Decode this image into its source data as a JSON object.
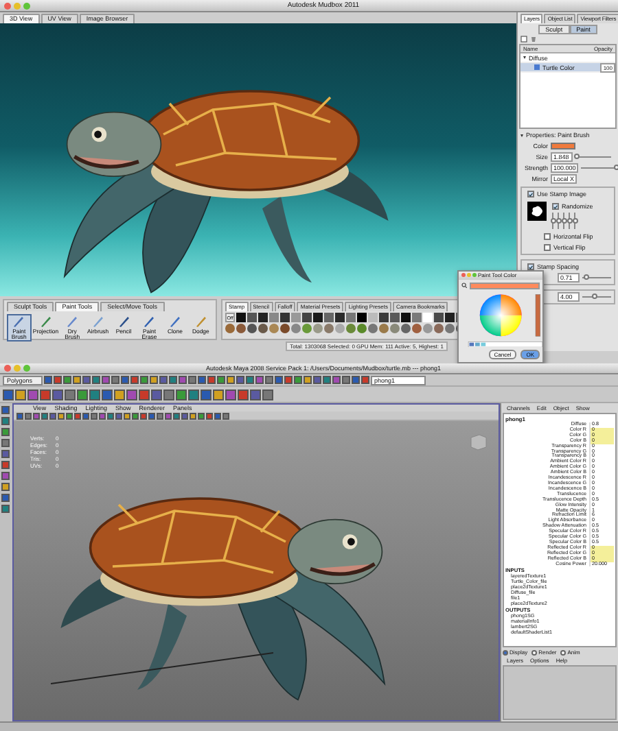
{
  "mudbox": {
    "title": "Autodesk Mudbox 2011",
    "view_tabs": [
      {
        "label": "3D View",
        "selected": true
      },
      {
        "label": "UV View",
        "selected": false
      },
      {
        "label": "Image Browser",
        "selected": false
      }
    ],
    "panel_tabs": [
      {
        "label": "Layers",
        "selected": true
      },
      {
        "label": "Object List",
        "selected": false
      },
      {
        "label": "Viewport Filters",
        "selected": false
      }
    ],
    "mode_buttons": [
      {
        "label": "Sculpt",
        "selected": false
      },
      {
        "label": "Paint",
        "selected": true
      }
    ],
    "layer_columns": [
      "Name",
      "Opacity"
    ],
    "layers": [
      {
        "name": "Diffuse",
        "expanded": true,
        "children": [
          {
            "name": "Turtle Color",
            "opacity": "100",
            "selected": true
          }
        ]
      }
    ],
    "properties": {
      "title": "Properties: Paint Brush",
      "expanded": true,
      "color_label": "Color",
      "color": "#f07a3c",
      "sliders": [
        {
          "label": "Size",
          "value": "1.848",
          "level": 0.05
        },
        {
          "label": "Strength",
          "value": "100.000",
          "level": 1
        }
      ],
      "mirror": {
        "label": "Mirror",
        "value": "Local X"
      },
      "stamp": {
        "label": "Use Stamp Image",
        "checked": true,
        "randomize": {
          "label": "Randomize",
          "checked": true,
          "sliders": [
            {
              "level": 0.5
            },
            {
              "level": 0.5
            },
            {
              "level": 0.5
            },
            {
              "level": 0.5
            },
            {
              "level": 0.5
            }
          ]
        },
        "flips": [
          {
            "label": "Horizontal Flip",
            "checked": false
          },
          {
            "label": "Vertical Flip",
            "checked": false
          }
        ]
      },
      "spacing": {
        "label": "Stamp Spacing",
        "checked": true,
        "value": "0.71",
        "level": 0.15
      },
      "second": {
        "value": "4.00",
        "level": 0.45
      }
    },
    "tool_tabs": [
      {
        "label": "Sculpt Tools",
        "selected": false
      },
      {
        "label": "Paint Tools",
        "selected": true
      },
      {
        "label": "Select/Move Tools",
        "selected": false
      }
    ],
    "tools": [
      {
        "label": "Paint Brush",
        "selected": true
      },
      {
        "label": "Projection",
        "selected": false
      },
      {
        "label": "Dry Brush",
        "selected": false
      },
      {
        "label": "Airbrush",
        "selected": false
      },
      {
        "label": "Pencil",
        "selected": false
      },
      {
        "label": "Paint Erase",
        "selected": false
      },
      {
        "label": "Clone",
        "selected": false
      },
      {
        "label": "Dodge",
        "selected": false
      }
    ],
    "tray_tabs": [
      {
        "label": "Stamp",
        "selected": true
      },
      {
        "label": "Stencil",
        "selected": false
      },
      {
        "label": "Falloff",
        "selected": false
      },
      {
        "label": "Material Presets",
        "selected": false
      },
      {
        "label": "Lighting Presets",
        "selected": false
      },
      {
        "label": "Camera Bookmarks",
        "selected": false
      }
    ],
    "stamp_off": "Off",
    "picker": {
      "title": "Paint Tool Color",
      "color": "#ff8a5c",
      "buttons": [
        "Cancel",
        "OK"
      ]
    },
    "status": "Total: 1303068 Selected: 0 GPU Mem: 111 Active: 5, Highest: 1"
  },
  "maya": {
    "title": "Autodesk Maya 2008 Service Pack 1: /Users/Documents/Mudbox/turtle.mb --- phong1",
    "menu_set": "Polygons",
    "field": "phong1",
    "panel_menu": [
      "View",
      "Shading",
      "Lighting",
      "Show",
      "Renderer",
      "Panels"
    ],
    "hud": [
      {
        "label": "Verts:",
        "value": "0"
      },
      {
        "label": "Edges:",
        "value": "0"
      },
      {
        "label": "Faces:",
        "value": "0"
      },
      {
        "label": "Tris:",
        "value": "0"
      },
      {
        "label": "UVs:",
        "value": "0"
      }
    ],
    "channel_tabs": [
      "Channels",
      "Edit",
      "Object",
      "Show"
    ],
    "node": "phong1",
    "attributes": [
      {
        "name": "Diffuse",
        "value": "0.8",
        "connected": false
      },
      {
        "name": "Color R",
        "value": "0",
        "connected": true
      },
      {
        "name": "Color G",
        "value": "0",
        "connected": true
      },
      {
        "name": "Color B",
        "value": "0",
        "connected": true
      },
      {
        "name": "Transparency R",
        "value": "0",
        "connected": false
      },
      {
        "name": "Transparency G",
        "value": "0",
        "connected": false
      },
      {
        "name": "Transparency B",
        "value": "0",
        "connected": false
      },
      {
        "name": "Ambient Color R",
        "value": "0",
        "connected": false
      },
      {
        "name": "Ambient Color G",
        "value": "0",
        "connected": false
      },
      {
        "name": "Ambient Color B",
        "value": "0",
        "connected": false
      },
      {
        "name": "Incandescence R",
        "value": "0",
        "connected": false
      },
      {
        "name": "Incandescence G",
        "value": "0",
        "connected": false
      },
      {
        "name": "Incandescence B",
        "value": "0",
        "connected": false
      },
      {
        "name": "Translucence",
        "value": "0",
        "connected": false
      },
      {
        "name": "Translucence Depth",
        "value": "0.5",
        "connected": false
      },
      {
        "name": "Glow Intensity",
        "value": "0",
        "connected": false
      },
      {
        "name": "Matte Opacity",
        "value": "1",
        "connected": false
      },
      {
        "name": "Refraction Limit",
        "value": "6",
        "connected": false
      },
      {
        "name": "Light Absorbance",
        "value": "0",
        "connected": false
      },
      {
        "name": "Shadow Attenuation",
        "value": "0.5",
        "connected": false
      },
      {
        "name": "Specular Color R",
        "value": "0.5",
        "connected": false
      },
      {
        "name": "Specular Color G",
        "value": "0.5",
        "connected": false
      },
      {
        "name": "Specular Color B",
        "value": "0.5",
        "connected": false
      },
      {
        "name": "Reflected Color R",
        "value": "0",
        "connected": true
      },
      {
        "name": "Reflected Color G",
        "value": "0",
        "connected": true
      },
      {
        "name": "Reflected Color B",
        "value": "0",
        "connected": true
      },
      {
        "name": "Cosine Power",
        "value": "20.000",
        "connected": false
      }
    ],
    "inputs_label": "INPUTS",
    "inputs": [
      "layeredTexture1",
      "Turtle_Color_file",
      "place2dTexture1",
      "Diffuse_file",
      "file1",
      "place2dTexture2"
    ],
    "outputs_label": "OUTPUTS",
    "outputs": [
      "phong1SG",
      "materialInfo1",
      "lambert2SG",
      "defaultShaderList1"
    ],
    "layer_modes": [
      {
        "label": "Display",
        "selected": true
      },
      {
        "label": "Render",
        "selected": false
      },
      {
        "label": "Anim",
        "selected": false
      }
    ],
    "layer_menu": [
      "Layers",
      "Options",
      "Help"
    ]
  }
}
